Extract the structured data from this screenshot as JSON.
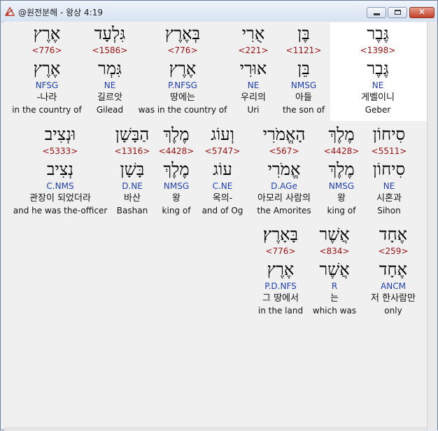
{
  "window": {
    "title": "@원전분해 - 왕상 4:19"
  },
  "row1": [
    {
      "heb": "גֶּבֶר",
      "strong": "<1398>",
      "heb2": "גֶּבֶר",
      "morph": "NE",
      "kor": "게벨이니",
      "eng": "Geber"
    },
    {
      "heb": "בֶּן",
      "strong": "<1121>",
      "heb2": "בֵּן",
      "morph": "NMSG",
      "kor": "아들",
      "eng": "the son of"
    },
    {
      "heb": "אֻרִי",
      "strong": "<221>",
      "heb2": "אוּרִי",
      "morph": "NE",
      "kor": "우리의",
      "eng": "Uri"
    },
    {
      "heb": "בְּאֶרֶץ",
      "strong": "<776>",
      "heb2": "אֶרֶץ",
      "morph": "P.NFSG",
      "kor": "땅에는",
      "eng": "was in the country of"
    },
    {
      "heb": "גִּלְעָד",
      "strong": "<1586>",
      "heb2": "גִּמְר",
      "morph": "NE",
      "kor": "길르앗",
      "eng": "Gilead"
    },
    {
      "heb": "אֶרֶץ",
      "strong": "<776>",
      "heb2": "אֶרֶץ",
      "morph": "NFSG",
      "kor": "-나라",
      "eng": "in the country of"
    }
  ],
  "row2": [
    {
      "heb": "סִיחוֹן",
      "strong": "<5511>",
      "heb2": "סִיחוֹן",
      "morph": "NE",
      "kor": "시혼과",
      "eng": "Sihon"
    },
    {
      "heb": "מֶלֶךְ",
      "strong": "<4428>",
      "heb2": "מֶלֶךְ",
      "morph": "NMSG",
      "kor": "왕",
      "eng": "king of"
    },
    {
      "heb": "הָאֱמֹרִי",
      "strong": "<567>",
      "heb2": "אֱמֹרִי",
      "morph": "D.AGe",
      "kor": "아모리 사람의",
      "eng": "the Amorites"
    },
    {
      "heb": "וְעוֹג",
      "strong": "<5747>",
      "heb2": "עוֹג",
      "morph": "C.NE",
      "kor": "옥의-",
      "eng": "and of Og"
    },
    {
      "heb": "מֶלֶךְ",
      "strong": "<4428>",
      "heb2": "מֶלֶךְ",
      "morph": "NMSG",
      "kor": "왕",
      "eng": "king of"
    },
    {
      "heb": "הַבָּשָׁן",
      "strong": "<1316>",
      "heb2": "בָּשָׁן",
      "morph": "D.NE",
      "kor": "바산",
      "eng": "Bashan"
    },
    {
      "heb": "וּנְצִיב",
      "strong": "<5333>",
      "heb2": "נְצִיב",
      "morph": "C.NMS",
      "kor": "관장이 되었더라",
      "eng": "and he was the-officer"
    }
  ],
  "row3": [
    {
      "heb": "אֶחָד",
      "strong": "<259>",
      "heb2": "אֶחָד",
      "morph": "ANCM",
      "kor": "저 한사람만",
      "eng": "only"
    },
    {
      "heb": "אֲשֶׁר",
      "strong": "<834>",
      "heb2": "אֲשֶׁר",
      "morph": "R",
      "kor": "는",
      "eng": "which was"
    },
    {
      "heb": "בָּאָרֶץ׃",
      "strong": "<776>",
      "heb2": "אֶרֶץ",
      "morph": "P.D.NFS",
      "kor": "그 땅에서",
      "eng": "in the land"
    }
  ],
  "colors": {
    "strong": "#9a1010",
    "morph": "#1f3fb8",
    "highlight": "#ffffff"
  },
  "icons": {
    "app": "bible-icon",
    "minimize": "minimize-icon",
    "maximize": "maximize-icon",
    "close": "close-icon"
  }
}
